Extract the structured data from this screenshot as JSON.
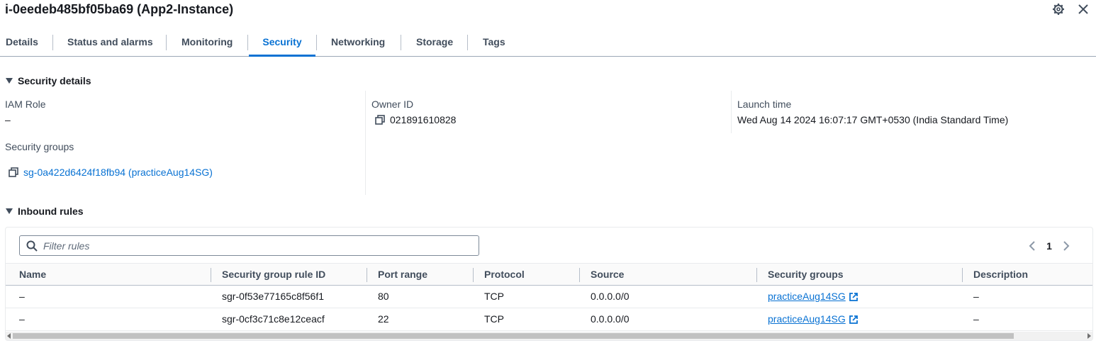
{
  "header": {
    "title": "i-0eedeb485bf05ba69 (App2-Instance)"
  },
  "tabs": [
    {
      "label": "Details"
    },
    {
      "label": "Status and alarms"
    },
    {
      "label": "Monitoring"
    },
    {
      "label": "Security",
      "active": true
    },
    {
      "label": "Networking"
    },
    {
      "label": "Storage"
    },
    {
      "label": "Tags"
    }
  ],
  "security_details": {
    "heading": "Security details",
    "iam_role": {
      "label": "IAM Role",
      "value": "–"
    },
    "owner_id": {
      "label": "Owner ID",
      "value": "021891610828"
    },
    "launch_time": {
      "label": "Launch time",
      "value": "Wed Aug 14 2024 16:07:17 GMT+0530 (India Standard Time)"
    },
    "security_groups": {
      "label": "Security groups",
      "value": "sg-0a422d6424f18fb94 (practiceAug14SG)"
    }
  },
  "inbound_rules": {
    "heading": "Inbound rules",
    "filter_placeholder": "Filter rules",
    "current_page": "1",
    "columns": [
      "Name",
      "Security group rule ID",
      "Port range",
      "Protocol",
      "Source",
      "Security groups",
      "Description"
    ],
    "rows": [
      {
        "name": "–",
        "rule_id": "sgr-0f53e77165c8f56f1",
        "port_range": "80",
        "protocol": "TCP",
        "source": "0.0.0.0/0",
        "security_group": "practiceAug14SG",
        "description": "–"
      },
      {
        "name": "–",
        "rule_id": "sgr-0cf3c71c8e12ceacf",
        "port_range": "22",
        "protocol": "TCP",
        "source": "0.0.0.0/0",
        "security_group": "practiceAug14SG",
        "description": "–"
      }
    ]
  },
  "colors": {
    "link": "#0972d3",
    "text": "#16191f",
    "secondary_text": "#414d5c"
  },
  "icons": [
    "settings-icon",
    "close-icon",
    "copy-icon",
    "search-icon",
    "chevron-left-icon",
    "chevron-right-icon",
    "external-link-icon",
    "caret-down-icon"
  ]
}
